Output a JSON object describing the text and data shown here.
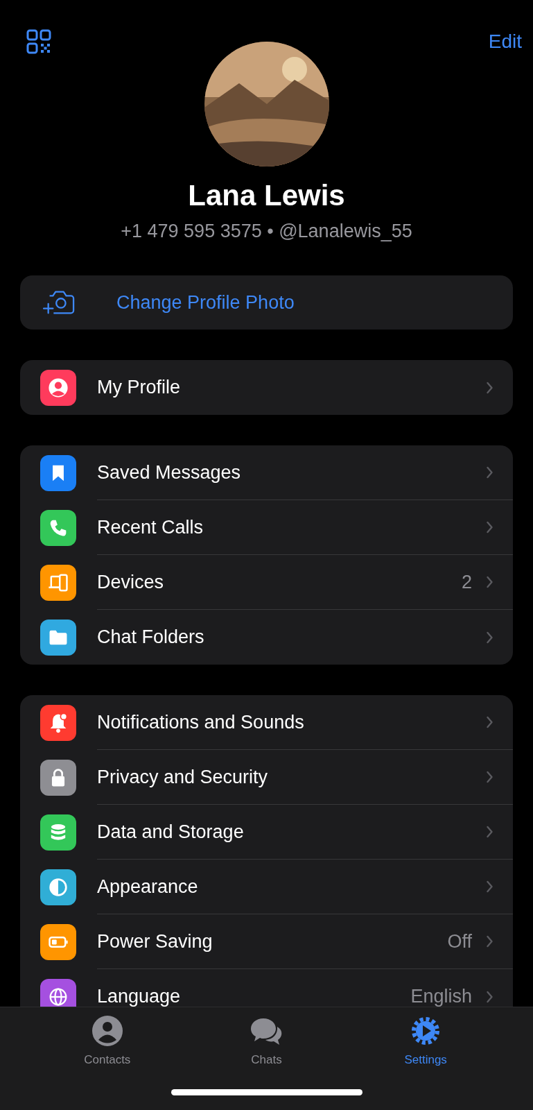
{
  "header": {
    "edit": "Edit"
  },
  "profile": {
    "name": "Lana Lewis",
    "details": "+1 479 595 3575 • @Lanalewis_55"
  },
  "photo_action": {
    "label": "Change Profile Photo"
  },
  "sections": [
    {
      "items": [
        {
          "label": "My Profile",
          "color": "#ff3b5c"
        }
      ]
    },
    {
      "items": [
        {
          "label": "Saved Messages",
          "color": "#1a7ff5"
        },
        {
          "label": "Recent Calls",
          "color": "#33c759"
        },
        {
          "label": "Devices",
          "value": "2",
          "color": "#ff9500"
        },
        {
          "label": "Chat Folders",
          "color": "#30a9e0"
        }
      ]
    },
    {
      "items": [
        {
          "label": "Notifications and Sounds",
          "color": "#ff3b30"
        },
        {
          "label": "Privacy and Security",
          "color": "#8e8e93"
        },
        {
          "label": "Data and Storage",
          "color": "#33c759"
        },
        {
          "label": "Appearance",
          "color": "#30aed6"
        },
        {
          "label": "Power Saving",
          "value": "Off",
          "color": "#ff9500"
        },
        {
          "label": "Language",
          "value": "English",
          "color": "#a550e0"
        }
      ]
    }
  ],
  "tabs": [
    {
      "label": "Contacts",
      "selected": false
    },
    {
      "label": "Chats",
      "selected": false
    },
    {
      "label": "Settings",
      "selected": true
    }
  ]
}
